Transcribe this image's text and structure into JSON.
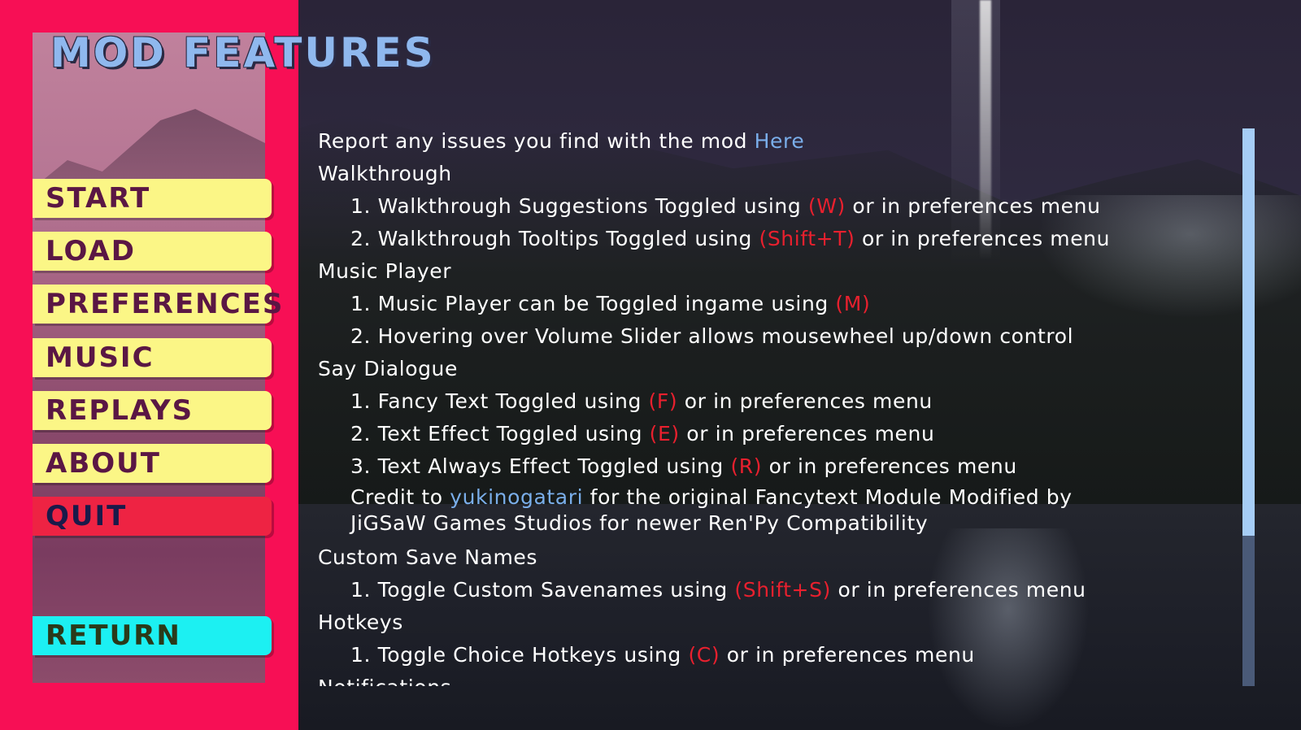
{
  "title": "MOD FEATURES",
  "menu": {
    "start": "START",
    "load": "LOAD",
    "preferences": "PREFERENCES",
    "music": "MUSIC",
    "replays": "REPLAYS",
    "about": "ABOUT",
    "quit": "QUIT",
    "return": "RETURN"
  },
  "content": {
    "report": {
      "text": "Report any issues you find with the mod ",
      "link": "Here"
    },
    "walkthrough": {
      "heading": "Walkthrough",
      "item1": {
        "pre": "1. Walkthrough Suggestions Toggled using ",
        "key": "(W)",
        "post": " or in preferences menu"
      },
      "item2": {
        "pre": "2. Walkthrough Tooltips Toggled using ",
        "key": "(Shift+T)",
        "post": " or in preferences menu"
      }
    },
    "music_player": {
      "heading": "Music Player",
      "item1": {
        "pre": "1. Music Player can be Toggled ingame using ",
        "key": "(M)"
      },
      "item2": "2. Hovering over Volume Slider allows mousewheel up/down control"
    },
    "say_dialogue": {
      "heading": "Say Dialogue",
      "item1": {
        "pre": "1. Fancy Text Toggled using ",
        "key": "(F)",
        "post": " or in preferences menu"
      },
      "item2": {
        "pre": "2. Text Effect Toggled using ",
        "key": "(E)",
        "post": " or in preferences menu"
      },
      "item3": {
        "pre": "3. Text Always Effect Toggled using ",
        "key": "(R)",
        "post": " or in preferences menu"
      },
      "credit": {
        "pre": "Credit to ",
        "link": "yukinogatari",
        "post": " for the original Fancytext Module Modified by",
        "line2": "JiGSaW Games Studios for newer Ren'Py Compatibility"
      }
    },
    "custom_save": {
      "heading": "Custom Save Names",
      "item1": {
        "pre": "1. Toggle Custom Savenames using ",
        "key": "(Shift+S)",
        "post": " or in preferences menu"
      }
    },
    "hotkeys": {
      "heading": "Hotkeys",
      "item1": {
        "pre": "1. Toggle Choice Hotkeys using ",
        "key": "(C)",
        "post": " or in preferences menu"
      }
    },
    "notifications": {
      "heading": "Notifications"
    }
  },
  "scrollbar": {
    "position_fraction": 0.0,
    "visible_fraction": 0.73
  }
}
